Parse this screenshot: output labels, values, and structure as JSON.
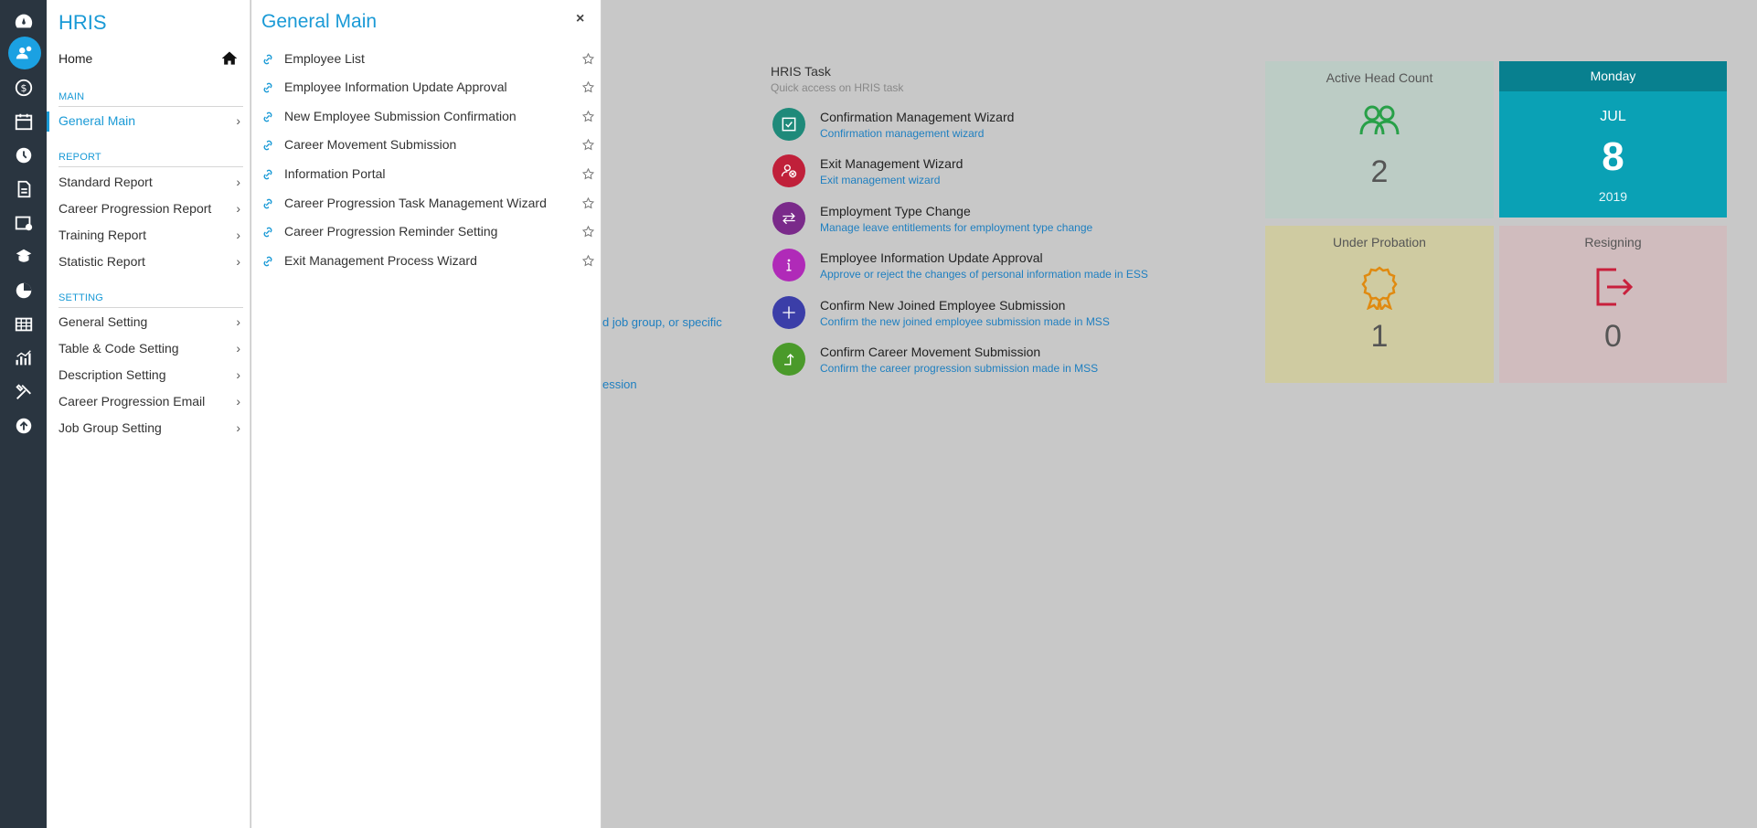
{
  "menu": {
    "title": "HRIS",
    "home_label": "Home",
    "sections": {
      "main": "MAIN",
      "report": "REPORT",
      "setting": "SETTING"
    },
    "main_items": [
      {
        "label": "General Main"
      }
    ],
    "report_items": [
      {
        "label": "Standard Report"
      },
      {
        "label": "Career Progression Report"
      },
      {
        "label": "Training Report"
      },
      {
        "label": "Statistic Report"
      }
    ],
    "setting_items": [
      {
        "label": "General Setting"
      },
      {
        "label": "Table & Code Setting"
      },
      {
        "label": "Description Setting"
      },
      {
        "label": "Career Progression Email"
      },
      {
        "label": "Job Group Setting"
      }
    ]
  },
  "submenu": {
    "title": "General Main",
    "close": "×",
    "items": [
      {
        "label": "Employee List"
      },
      {
        "label": "Employee Information Update Approval"
      },
      {
        "label": "New Employee Submission Confirmation"
      },
      {
        "label": "Career Movement Submission"
      },
      {
        "label": "Information Portal"
      },
      {
        "label": "Career Progression Task Management Wizard"
      },
      {
        "label": "Career Progression Reminder Setting"
      },
      {
        "label": "Exit Management Process Wizard"
      }
    ]
  },
  "fragments": {
    "line1": "d job group, or specific",
    "line2": "ession"
  },
  "tasks": {
    "title": "HRIS Task",
    "subtitle": "Quick access on HRIS task",
    "items": [
      {
        "name": "Confirmation Management Wizard",
        "desc": "Confirmation management wizard",
        "color": "#1f8a7a",
        "icon": "check-square-icon"
      },
      {
        "name": "Exit Management Wizard",
        "desc": "Exit management wizard",
        "color": "#c0203a",
        "icon": "user-remove-icon"
      },
      {
        "name": "Employment Type Change",
        "desc": "Manage leave entitlements for employment type change",
        "color": "#7a2a8a",
        "icon": "swap-arrows-icon"
      },
      {
        "name": "Employee Information Update Approval",
        "desc": "Approve or reject the changes of personal information made in ESS",
        "color": "#b02ab8",
        "icon": "info-icon"
      },
      {
        "name": "Confirm New Joined Employee Submission",
        "desc": "Confirm the new joined employee submission made in MSS",
        "color": "#3b3ea8",
        "icon": "plus-icon"
      },
      {
        "name": "Confirm Career Movement Submission",
        "desc": "Confirm the career progression submission made in MSS",
        "color": "#4a9a2a",
        "icon": "arrow-up-right-icon"
      }
    ]
  },
  "stats": {
    "active_head_count": {
      "label": "Active Head Count",
      "value": "2",
      "color": "#28a048"
    },
    "under_probation": {
      "label": "Under Probation",
      "value": "1",
      "color": "#e08a10"
    },
    "resigning": {
      "label": "Resigning",
      "value": "0",
      "color": "#c8203c"
    }
  },
  "date": {
    "weekday": "Monday",
    "month": "JUL",
    "day": "8",
    "year": "2019"
  }
}
